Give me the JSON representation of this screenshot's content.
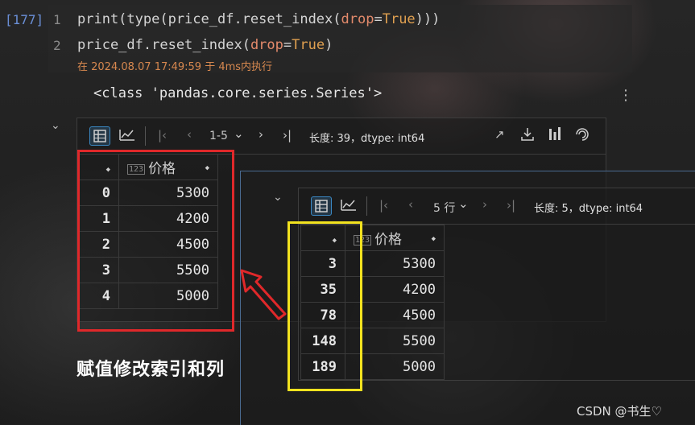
{
  "cell": {
    "exec_count": "[177]",
    "lines": [
      {
        "num": "1",
        "p1": "print(type(price_df.reset_index(",
        "param": "drop",
        "eq": "=",
        "const": "True",
        "p2": ")))"
      },
      {
        "num": "2",
        "p1": "price_df.reset_index(",
        "param": "drop",
        "eq": "=",
        "const": "True",
        "p2": ")"
      }
    ],
    "meta": "在 2024.08.07 17:49:59 于 4ms内执行"
  },
  "output": {
    "text": "<class 'pandas.core.series.Series'>",
    "kebab": "⋮"
  },
  "table1": {
    "pager": "1-5",
    "info": "长度: 39，dtype: int64",
    "sort_icon": "◆",
    "col_header": "价格",
    "badge": "123",
    "rows": [
      {
        "idx": "0",
        "val": "5300"
      },
      {
        "idx": "1",
        "val": "4200"
      },
      {
        "idx": "2",
        "val": "4500"
      },
      {
        "idx": "3",
        "val": "5500"
      },
      {
        "idx": "4",
        "val": "5000"
      }
    ]
  },
  "table2": {
    "pager": "5 行",
    "info": "长度: 5，dtype: int64",
    "sort_icon": "◆",
    "col_header": "价格",
    "badge": "123",
    "rows": [
      {
        "idx": "3",
        "val": "5300"
      },
      {
        "idx": "35",
        "val": "4200"
      },
      {
        "idx": "78",
        "val": "4500"
      },
      {
        "idx": "148",
        "val": "5500"
      },
      {
        "idx": "189",
        "val": "5000"
      }
    ]
  },
  "caption": "赋值修改索引和列",
  "watermark": "CSDN @书生♡",
  "icons": {
    "first": "|‹",
    "prev": "‹",
    "next": "›",
    "last": "›|",
    "chevron": "⌄",
    "collapse": "⌄"
  },
  "colors": {
    "red_box": "#e0282a",
    "yellow_box": "#f2e21f",
    "accent": "#3b88c3"
  }
}
